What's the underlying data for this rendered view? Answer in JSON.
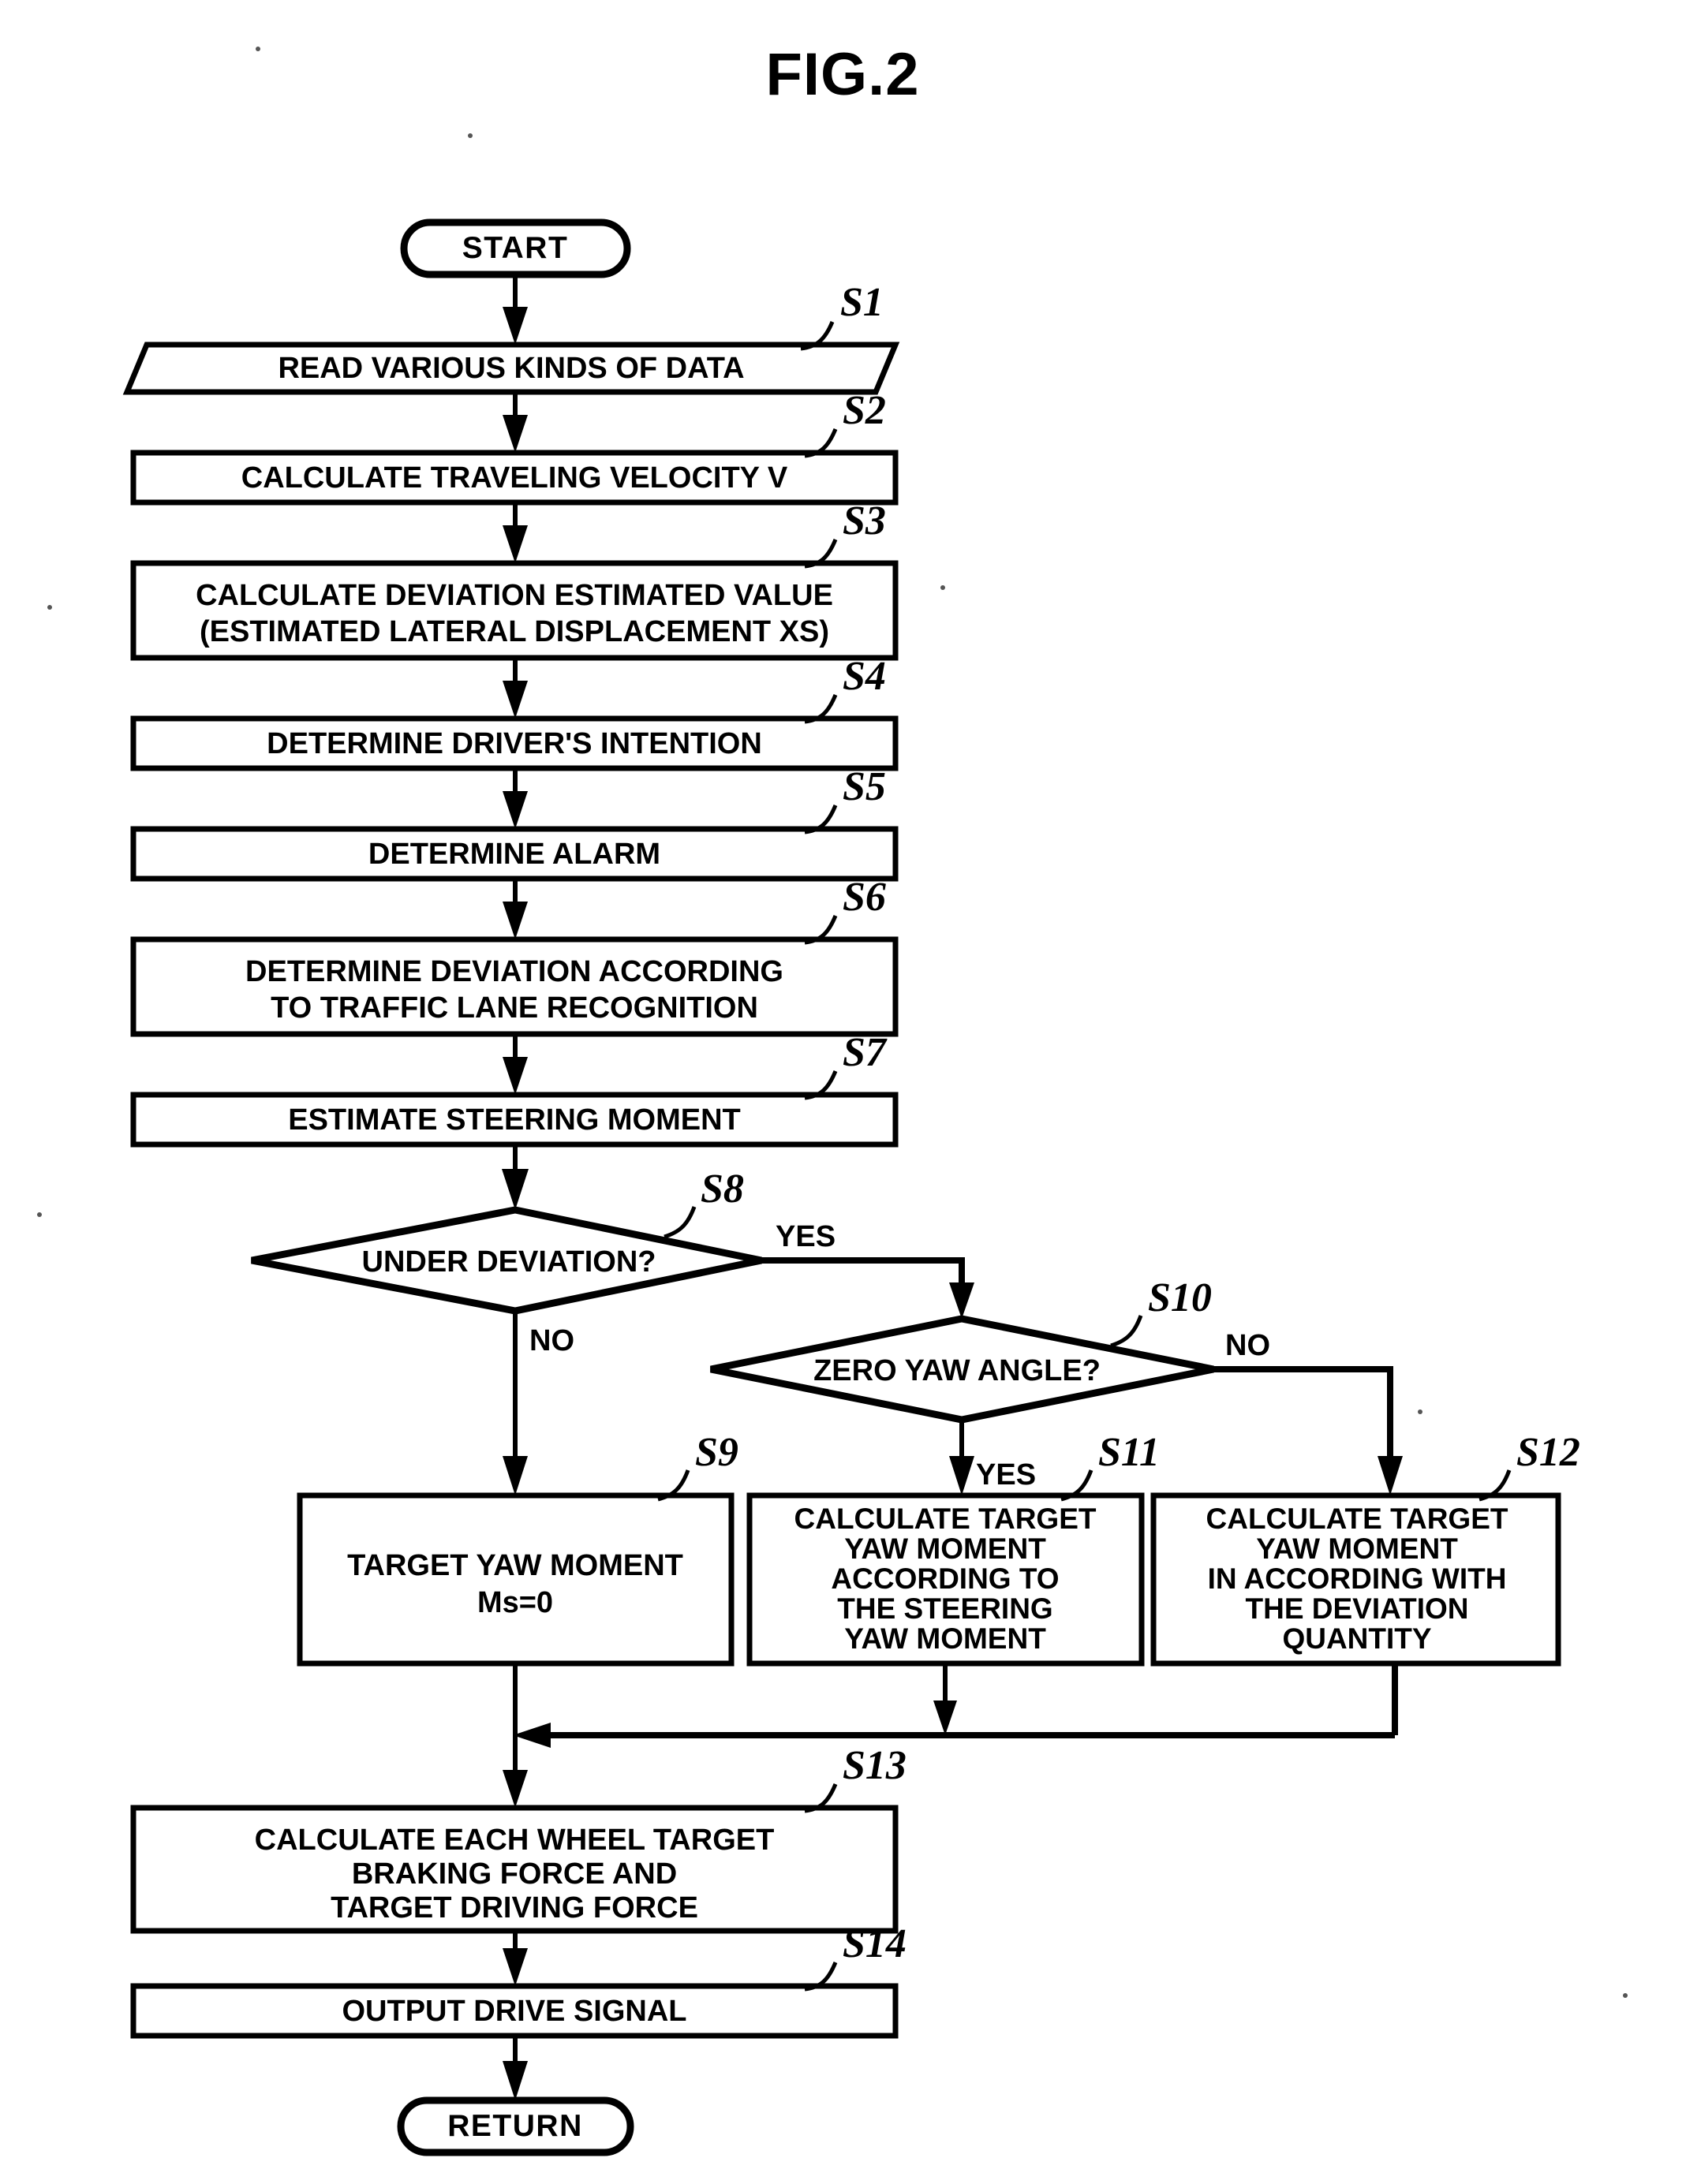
{
  "figure": {
    "title": "FIG.2",
    "type": "flowchart"
  },
  "terminators": {
    "start": "START",
    "end": "RETURN"
  },
  "branch_labels": {
    "s8_yes": "YES",
    "s8_no": "NO",
    "s10_yes": "YES",
    "s10_no": "NO"
  },
  "nodes": [
    {
      "id": "S1",
      "step": "S1",
      "shape": "parallelogram",
      "lines": [
        "READ VARIOUS KINDS OF DATA"
      ]
    },
    {
      "id": "S2",
      "step": "S2",
      "shape": "process",
      "lines": [
        "CALCULATE TRAVELING VELOCITY V"
      ]
    },
    {
      "id": "S3",
      "step": "S3",
      "shape": "process",
      "lines": [
        "CALCULATE DEVIATION ESTIMATED VALUE",
        "(ESTIMATED LATERAL DISPLACEMENT XS)"
      ]
    },
    {
      "id": "S4",
      "step": "S4",
      "shape": "process",
      "lines": [
        "DETERMINE DRIVER'S INTENTION"
      ]
    },
    {
      "id": "S5",
      "step": "S5",
      "shape": "process",
      "lines": [
        "DETERMINE ALARM"
      ]
    },
    {
      "id": "S6",
      "step": "S6",
      "shape": "process",
      "lines": [
        "DETERMINE DEVIATION ACCORDING",
        "TO TRAFFIC LANE RECOGNITION"
      ]
    },
    {
      "id": "S7",
      "step": "S7",
      "shape": "process",
      "lines": [
        "ESTIMATE STEERING MOMENT"
      ]
    },
    {
      "id": "S8",
      "step": "S8",
      "shape": "decision",
      "lines": [
        "UNDER DEVIATION?"
      ]
    },
    {
      "id": "S9",
      "step": "S9",
      "shape": "process",
      "lines": [
        "TARGET YAW MOMENT",
        "Ms=0"
      ]
    },
    {
      "id": "S10",
      "step": "S10",
      "shape": "decision",
      "lines": [
        "ZERO YAW ANGLE?"
      ]
    },
    {
      "id": "S11",
      "step": "S11",
      "shape": "process",
      "lines": [
        "CALCULATE TARGET",
        "YAW MOMENT",
        "ACCORDING TO",
        "THE STEERING",
        "YAW MOMENT"
      ]
    },
    {
      "id": "S12",
      "step": "S12",
      "shape": "process",
      "lines": [
        "CALCULATE TARGET",
        "YAW MOMENT",
        "IN ACCORDING WITH",
        "THE DEVIATION",
        "QUANTITY"
      ]
    },
    {
      "id": "S13",
      "step": "S13",
      "shape": "process",
      "lines": [
        "CALCULATE EACH WHEEL TARGET",
        "BRAKING FORCE AND",
        "TARGET DRIVING FORCE"
      ]
    },
    {
      "id": "S14",
      "step": "S14",
      "shape": "process",
      "lines": [
        "OUTPUT DRIVE SIGNAL"
      ]
    }
  ],
  "text": {
    "title": "FIG.2",
    "start": "START",
    "return": "RETURN",
    "s1_step": "S1",
    "s1_l1": "READ VARIOUS KINDS OF DATA",
    "s2_step": "S2",
    "s2_l1": "CALCULATE TRAVELING VELOCITY V",
    "s3_step": "S3",
    "s3_l1": "CALCULATE DEVIATION ESTIMATED VALUE",
    "s3_l2": "(ESTIMATED LATERAL DISPLACEMENT XS)",
    "s4_step": "S4",
    "s4_l1": "DETERMINE DRIVER'S INTENTION",
    "s5_step": "S5",
    "s5_l1": "DETERMINE ALARM",
    "s6_step": "S6",
    "s6_l1": "DETERMINE DEVIATION ACCORDING",
    "s6_l2": "TO TRAFFIC LANE RECOGNITION",
    "s7_step": "S7",
    "s7_l1": "ESTIMATE STEERING MOMENT",
    "s8_step": "S8",
    "s8_l1": "UNDER DEVIATION?",
    "s8_yes": "YES",
    "s8_no": "NO",
    "s9_step": "S9",
    "s9_l1": "TARGET YAW MOMENT",
    "s9_l2": "Ms=0",
    "s10_step": "S10",
    "s10_l1": "ZERO YAW ANGLE?",
    "s10_yes": "YES",
    "s10_no": "NO",
    "s11_step": "S11",
    "s11_l1": "CALCULATE TARGET",
    "s11_l2": "YAW MOMENT",
    "s11_l3": "ACCORDING TO",
    "s11_l4": "THE STEERING",
    "s11_l5": "YAW MOMENT",
    "s12_step": "S12",
    "s12_l1": "CALCULATE TARGET",
    "s12_l2": "YAW MOMENT",
    "s12_l3": "IN ACCORDING WITH",
    "s12_l4": "THE DEVIATION",
    "s12_l5": "QUANTITY",
    "s13_step": "S13",
    "s13_l1": "CALCULATE EACH WHEEL TARGET",
    "s13_l2": "BRAKING FORCE AND",
    "s13_l3": "TARGET DRIVING FORCE",
    "s14_step": "S14",
    "s14_l1": "OUTPUT DRIVE SIGNAL"
  },
  "colors": {
    "ink": "#000000",
    "paper": "#ffffff"
  }
}
